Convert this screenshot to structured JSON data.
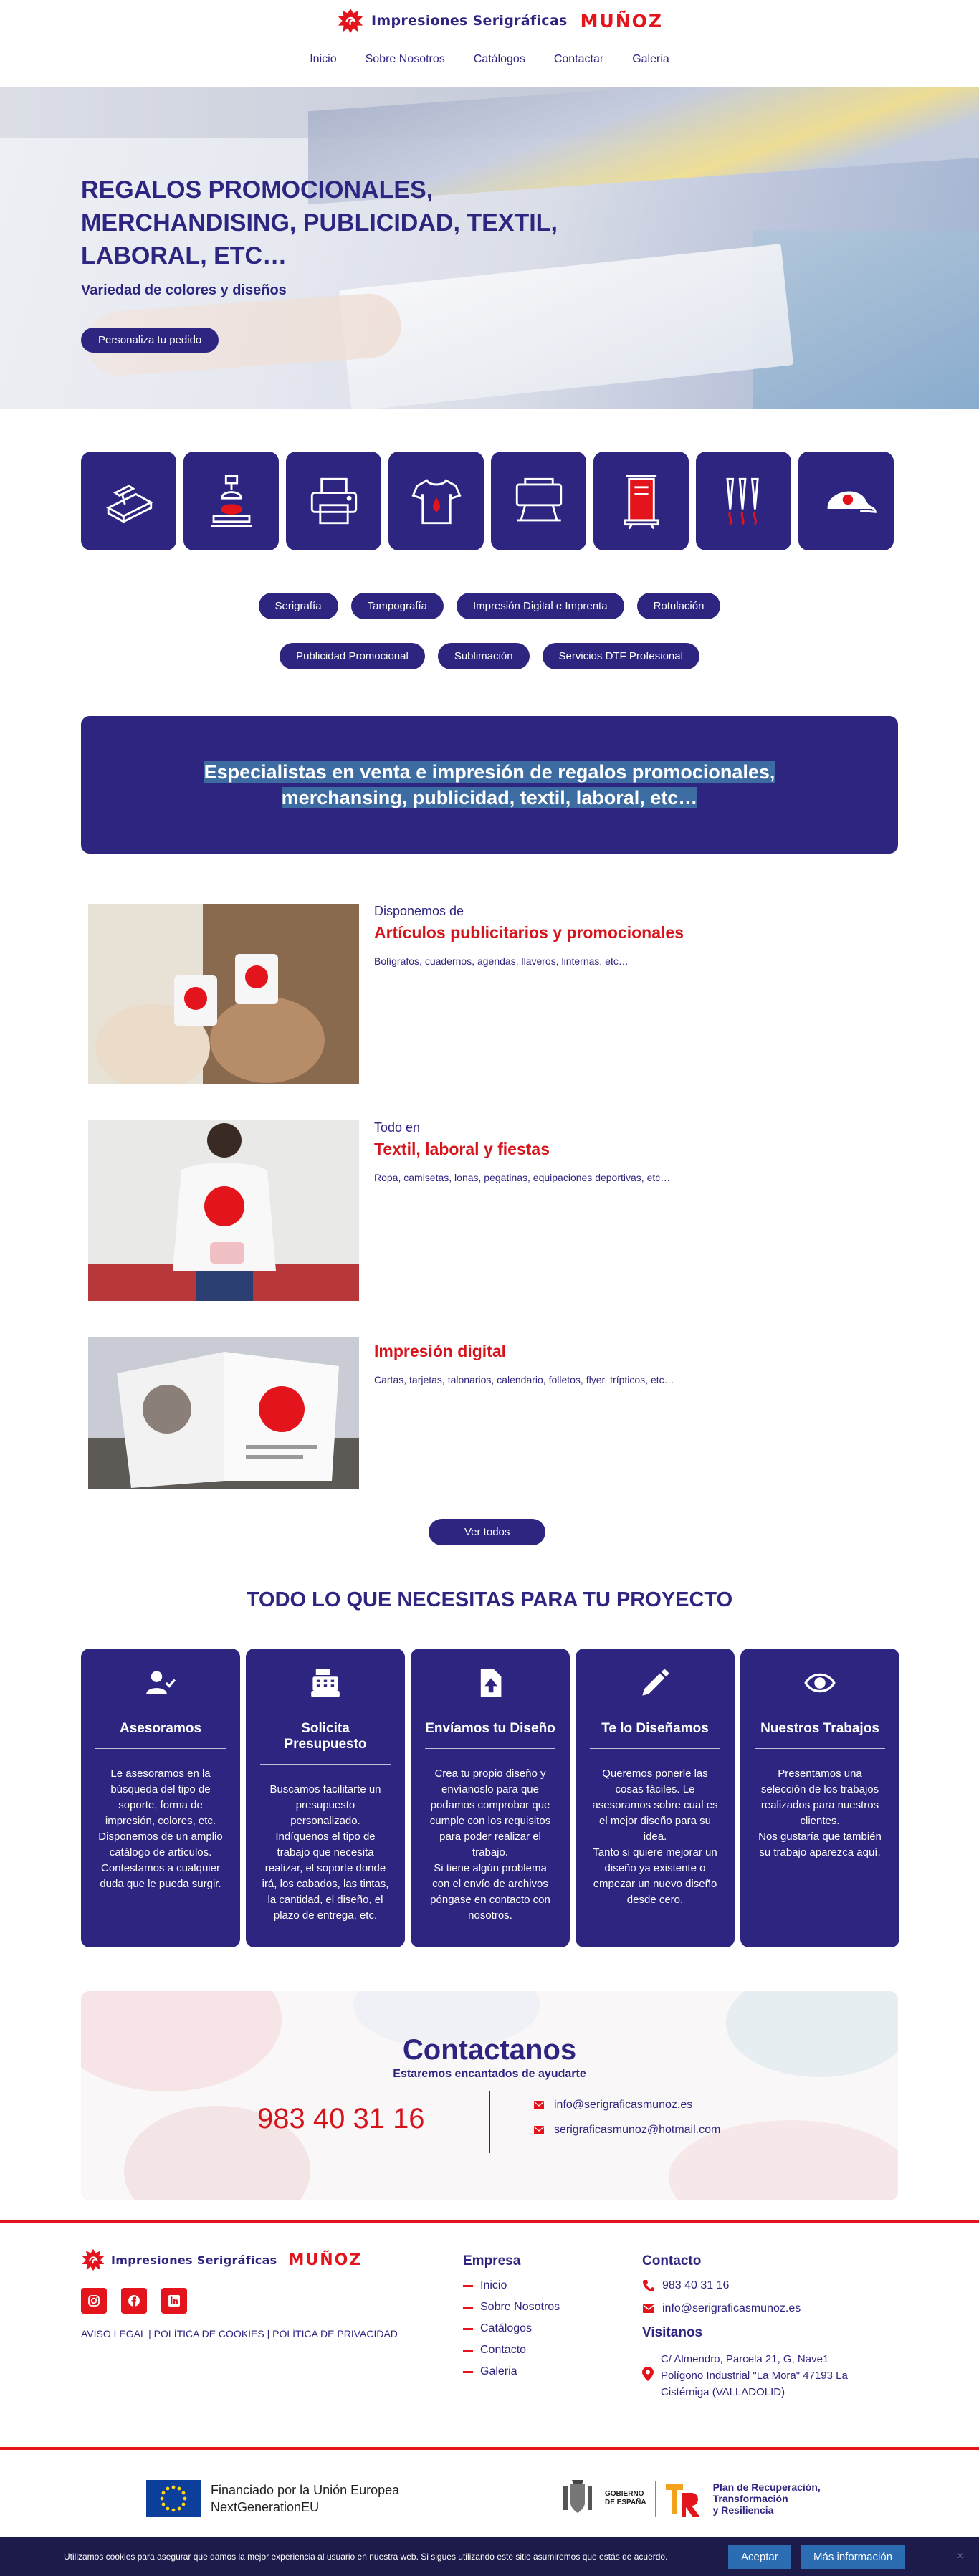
{
  "header": {
    "logo_text": "Impresiones Serigráficas",
    "logo_brand": "MUÑOZ",
    "nav": [
      "Inicio",
      "Sobre Nosotros",
      "Catálogos",
      "Contactar",
      "Galeria"
    ]
  },
  "hero": {
    "title": "REGALOS PROMOCIONALES, MERCHANDISING, PUBLICIDAD, TEXTIL, LABORAL, ETC…",
    "subtitle": "Variedad de colores y diseños",
    "button": "Personaliza tu pedido"
  },
  "tiles": [
    "screen-printing-squeegee-icon",
    "pad-printing-machine-icon",
    "printer-icon",
    "tshirt-ink-icon",
    "sign-stand-icon",
    "rollup-banner-icon",
    "markers-icon",
    "cap-icon"
  ],
  "categories": {
    "row1": [
      "Serigrafía",
      "Tampografía",
      "Impresión Digital e Imprenta",
      "Rotulación"
    ],
    "row2": [
      "Publicidad Promocional",
      "Sublimación",
      "Servicios DTF Profesional"
    ]
  },
  "banner": {
    "text": "Especialistas en venta e impresión de regalos promocionales, merchansing, publicidad, textil, laboral, etc…"
  },
  "products": [
    {
      "pre": "Disponemos de",
      "title": "Artículos publicitarios y promocionales",
      "desc": "Bolígrafos, cuadernos, agendas, llaveros, linternas, etc…"
    },
    {
      "pre": "Todo en",
      "title": "Textil, laboral y fiestas",
      "desc": "Ropa, camisetas, lonas, pegatinas, equipaciones deportivas, etc…"
    },
    {
      "pre": "",
      "title": "Impresión digital",
      "desc": "Cartas, tarjetas, talonarios, calendario, folletos, flyer, trípticos, etc…"
    }
  ],
  "ver_todos": "Ver todos",
  "section_title": "TODO LO QUE NECESITAS PARA TU PROYECTO",
  "services": [
    {
      "icon": "user-check-icon",
      "title": "Asesoramos",
      "text": "Le asesoramos en la búsqueda del tipo de soporte, forma de impresión, colores, etc.\nDisponemos de un amplio catálogo de artículos.\nContestamos a cualquier duda que le pueda surgir."
    },
    {
      "icon": "cash-register-icon",
      "title": "Solicita Presupuesto",
      "text": "Buscamos facilitarte un presupuesto personalizado.\nIndíquenos el tipo de trabajo que necesita realizar, el soporte donde irá, los cabados, las tintas, la cantidad, el diseño, el plazo de entrega, etc."
    },
    {
      "icon": "file-upload-icon",
      "title": "Envíamos tu Diseño",
      "text": "Crea tu propio diseño y envíanoslo para que podamos comprobar que cumple con los requisitos para poder realizar el trabajo.\nSi tiene algún problema con el envío de archivos póngase en contacto con nosotros."
    },
    {
      "icon": "pencil-icon",
      "title": "Te lo Diseñamos",
      "text": "Queremos ponerle las cosas fáciles. Le asesoramos sobre cual es el mejor diseño para su idea.\nTanto si quiere mejorar un diseño ya existente o empezar un nuevo diseño desde cero."
    },
    {
      "icon": "eye-icon",
      "title": "Nuestros Trabajos",
      "text": "Presentamos una selección de los trabajos realizados para nuestros clientes.\nNos gustaría que también su trabajo aparezca aquí."
    }
  ],
  "contact": {
    "title": "Contactanos",
    "subtitle": "Estaremos encantados de ayudarte",
    "phone": "983 40 31 16",
    "emails": [
      "info@serigraficasmunoz.es",
      "serigraficasmunoz@hotmail.com"
    ]
  },
  "footer": {
    "legal": "AVISO LEGAL | POLÍTICA DE COOKIES | POLÍTICA DE PRIVACIDAD",
    "empresa_title": "Empresa",
    "empresa_links": [
      "Inicio",
      "Sobre Nosotros",
      "Catálogos",
      "Contacto",
      "Galeria"
    ],
    "contacto_title": "Contacto",
    "phone": "983 40 31 16",
    "email": "info@serigraficasmunoz.es",
    "visitanos_title": "Visitanos",
    "address": "C/ Almendro, Parcela 21, G, Nave1\nPolígono Industrial \"La Mora\" 47193 La Cistérniga  (VALLADOLID)"
  },
  "funding": {
    "eu_line1": "Financiado por la Unión Europea",
    "eu_line2": "NextGenerationEU",
    "gov_label": "GOBIERNO\nDE ESPAÑA",
    "prtr": "Plan de Recuperación,\nTransformación\ny Resiliencia"
  },
  "cookies": {
    "text": "Utilizamos cookies para asegurar que damos la mejor experiencia al usuario en nuestra web. Si sigues utilizando este sitio asumiremos que estás de acuerdo.",
    "accept": "Aceptar",
    "more": "Más información",
    "close": "×"
  },
  "colors": {
    "primary": "#2e2580",
    "accent": "#e3141b",
    "cookie_bg": "#1d1a4c",
    "cookie_btn": "#2b6cb3"
  }
}
